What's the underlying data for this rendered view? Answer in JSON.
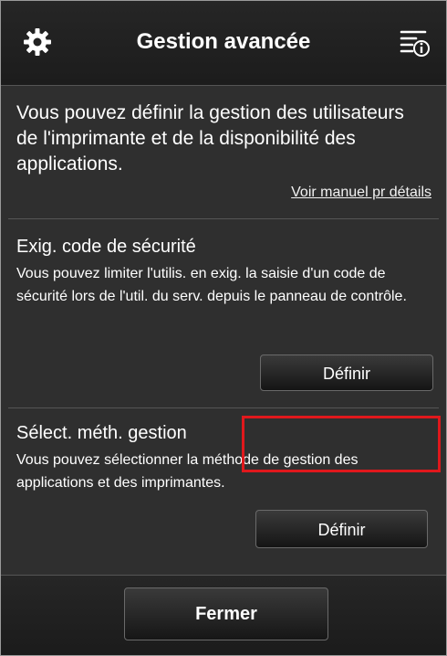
{
  "header": {
    "title": "Gestion avancée",
    "left_icon": "gear-icon",
    "right_icon": "menu-info-icon"
  },
  "intro": {
    "text": "Vous pouvez définir la gestion des utilisateurs de l'imprimante et de la disponibilité des applications.",
    "manual_link": "Voir manuel pr détails"
  },
  "sections": [
    {
      "title": "Exig. code de sécurité",
      "description": "Vous pouvez limiter l'utilis. en exig. la saisie d'un code de sécurité lors de l'util. du serv. depuis le panneau de contrôle.",
      "button": "Définir"
    },
    {
      "title": "Sélect. méth. gestion",
      "description": "Vous pouvez sélectionner la méthode de gestion des applications et des imprimantes.",
      "button": "Définir"
    }
  ],
  "footer": {
    "close_label": "Fermer"
  },
  "colors": {
    "highlight": "#e0181c",
    "background": "#2f2f2f"
  }
}
